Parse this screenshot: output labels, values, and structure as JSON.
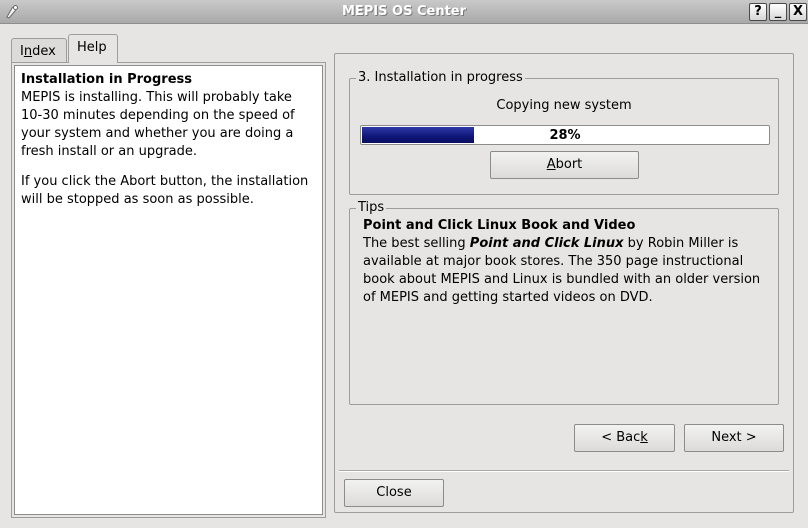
{
  "window": {
    "title": "MEPIS OS Center",
    "help_button": "?",
    "min_button": "_",
    "close_button": "X"
  },
  "tabs": {
    "index_pre": "I",
    "index_ul": "n",
    "index_post": "dex",
    "help": "Help"
  },
  "help_panel": {
    "title": "Installation in Progress",
    "paragraph1": "MEPIS is installing. This will probably take 10-30 minutes depending on the speed of your system and whether you are doing a fresh install or an upgrade.",
    "paragraph2": "If you click the Abort button, the installation will be stopped as soon as possible."
  },
  "install_group": {
    "legend": "3. Installation in progress",
    "status": "Copying new system",
    "progress_percent": 28,
    "progress_label": "28%",
    "abort_ul": "A",
    "abort_rest": "bort"
  },
  "tips_group": {
    "legend": "Tips",
    "title": "Point and Click Linux Book and Video",
    "text_pre": "The best selling ",
    "text_book": "Point and Click Linux",
    "text_post": " by Robin Miller is available at major book stores. The 350 page instructional book about MEPIS and Linux is bundled with an older version of MEPIS and getting started videos on DVD."
  },
  "nav": {
    "back_pre": "< Bac",
    "back_ul": "k",
    "next_label": "Next >",
    "close_label": "Close"
  }
}
